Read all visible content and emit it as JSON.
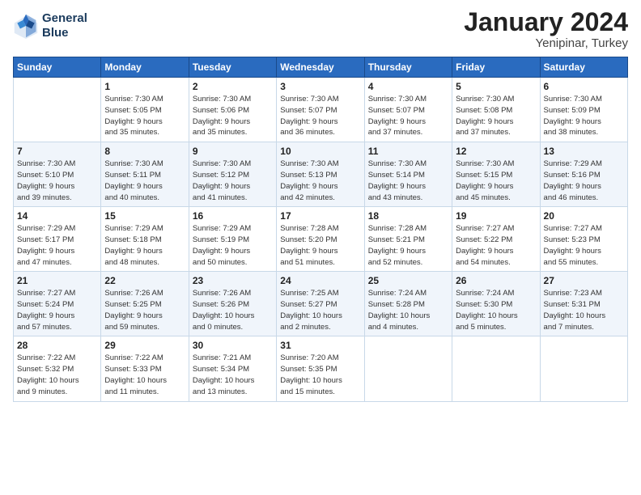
{
  "logo": {
    "line1": "General",
    "line2": "Blue"
  },
  "title": "January 2024",
  "subtitle": "Yenipinar, Turkey",
  "header": {
    "days": [
      "Sunday",
      "Monday",
      "Tuesday",
      "Wednesday",
      "Thursday",
      "Friday",
      "Saturday"
    ]
  },
  "weeks": [
    {
      "cells": [
        {
          "day": "",
          "info": ""
        },
        {
          "day": "1",
          "info": "Sunrise: 7:30 AM\nSunset: 5:05 PM\nDaylight: 9 hours\nand 35 minutes."
        },
        {
          "day": "2",
          "info": "Sunrise: 7:30 AM\nSunset: 5:06 PM\nDaylight: 9 hours\nand 35 minutes."
        },
        {
          "day": "3",
          "info": "Sunrise: 7:30 AM\nSunset: 5:07 PM\nDaylight: 9 hours\nand 36 minutes."
        },
        {
          "day": "4",
          "info": "Sunrise: 7:30 AM\nSunset: 5:07 PM\nDaylight: 9 hours\nand 37 minutes."
        },
        {
          "day": "5",
          "info": "Sunrise: 7:30 AM\nSunset: 5:08 PM\nDaylight: 9 hours\nand 37 minutes."
        },
        {
          "day": "6",
          "info": "Sunrise: 7:30 AM\nSunset: 5:09 PM\nDaylight: 9 hours\nand 38 minutes."
        }
      ]
    },
    {
      "cells": [
        {
          "day": "7",
          "info": "Sunrise: 7:30 AM\nSunset: 5:10 PM\nDaylight: 9 hours\nand 39 minutes."
        },
        {
          "day": "8",
          "info": "Sunrise: 7:30 AM\nSunset: 5:11 PM\nDaylight: 9 hours\nand 40 minutes."
        },
        {
          "day": "9",
          "info": "Sunrise: 7:30 AM\nSunset: 5:12 PM\nDaylight: 9 hours\nand 41 minutes."
        },
        {
          "day": "10",
          "info": "Sunrise: 7:30 AM\nSunset: 5:13 PM\nDaylight: 9 hours\nand 42 minutes."
        },
        {
          "day": "11",
          "info": "Sunrise: 7:30 AM\nSunset: 5:14 PM\nDaylight: 9 hours\nand 43 minutes."
        },
        {
          "day": "12",
          "info": "Sunrise: 7:30 AM\nSunset: 5:15 PM\nDaylight: 9 hours\nand 45 minutes."
        },
        {
          "day": "13",
          "info": "Sunrise: 7:29 AM\nSunset: 5:16 PM\nDaylight: 9 hours\nand 46 minutes."
        }
      ]
    },
    {
      "cells": [
        {
          "day": "14",
          "info": "Sunrise: 7:29 AM\nSunset: 5:17 PM\nDaylight: 9 hours\nand 47 minutes."
        },
        {
          "day": "15",
          "info": "Sunrise: 7:29 AM\nSunset: 5:18 PM\nDaylight: 9 hours\nand 48 minutes."
        },
        {
          "day": "16",
          "info": "Sunrise: 7:29 AM\nSunset: 5:19 PM\nDaylight: 9 hours\nand 50 minutes."
        },
        {
          "day": "17",
          "info": "Sunrise: 7:28 AM\nSunset: 5:20 PM\nDaylight: 9 hours\nand 51 minutes."
        },
        {
          "day": "18",
          "info": "Sunrise: 7:28 AM\nSunset: 5:21 PM\nDaylight: 9 hours\nand 52 minutes."
        },
        {
          "day": "19",
          "info": "Sunrise: 7:27 AM\nSunset: 5:22 PM\nDaylight: 9 hours\nand 54 minutes."
        },
        {
          "day": "20",
          "info": "Sunrise: 7:27 AM\nSunset: 5:23 PM\nDaylight: 9 hours\nand 55 minutes."
        }
      ]
    },
    {
      "cells": [
        {
          "day": "21",
          "info": "Sunrise: 7:27 AM\nSunset: 5:24 PM\nDaylight: 9 hours\nand 57 minutes."
        },
        {
          "day": "22",
          "info": "Sunrise: 7:26 AM\nSunset: 5:25 PM\nDaylight: 9 hours\nand 59 minutes."
        },
        {
          "day": "23",
          "info": "Sunrise: 7:26 AM\nSunset: 5:26 PM\nDaylight: 10 hours\nand 0 minutes."
        },
        {
          "day": "24",
          "info": "Sunrise: 7:25 AM\nSunset: 5:27 PM\nDaylight: 10 hours\nand 2 minutes."
        },
        {
          "day": "25",
          "info": "Sunrise: 7:24 AM\nSunset: 5:28 PM\nDaylight: 10 hours\nand 4 minutes."
        },
        {
          "day": "26",
          "info": "Sunrise: 7:24 AM\nSunset: 5:30 PM\nDaylight: 10 hours\nand 5 minutes."
        },
        {
          "day": "27",
          "info": "Sunrise: 7:23 AM\nSunset: 5:31 PM\nDaylight: 10 hours\nand 7 minutes."
        }
      ]
    },
    {
      "cells": [
        {
          "day": "28",
          "info": "Sunrise: 7:22 AM\nSunset: 5:32 PM\nDaylight: 10 hours\nand 9 minutes."
        },
        {
          "day": "29",
          "info": "Sunrise: 7:22 AM\nSunset: 5:33 PM\nDaylight: 10 hours\nand 11 minutes."
        },
        {
          "day": "30",
          "info": "Sunrise: 7:21 AM\nSunset: 5:34 PM\nDaylight: 10 hours\nand 13 minutes."
        },
        {
          "day": "31",
          "info": "Sunrise: 7:20 AM\nSunset: 5:35 PM\nDaylight: 10 hours\nand 15 minutes."
        },
        {
          "day": "",
          "info": ""
        },
        {
          "day": "",
          "info": ""
        },
        {
          "day": "",
          "info": ""
        }
      ]
    }
  ]
}
